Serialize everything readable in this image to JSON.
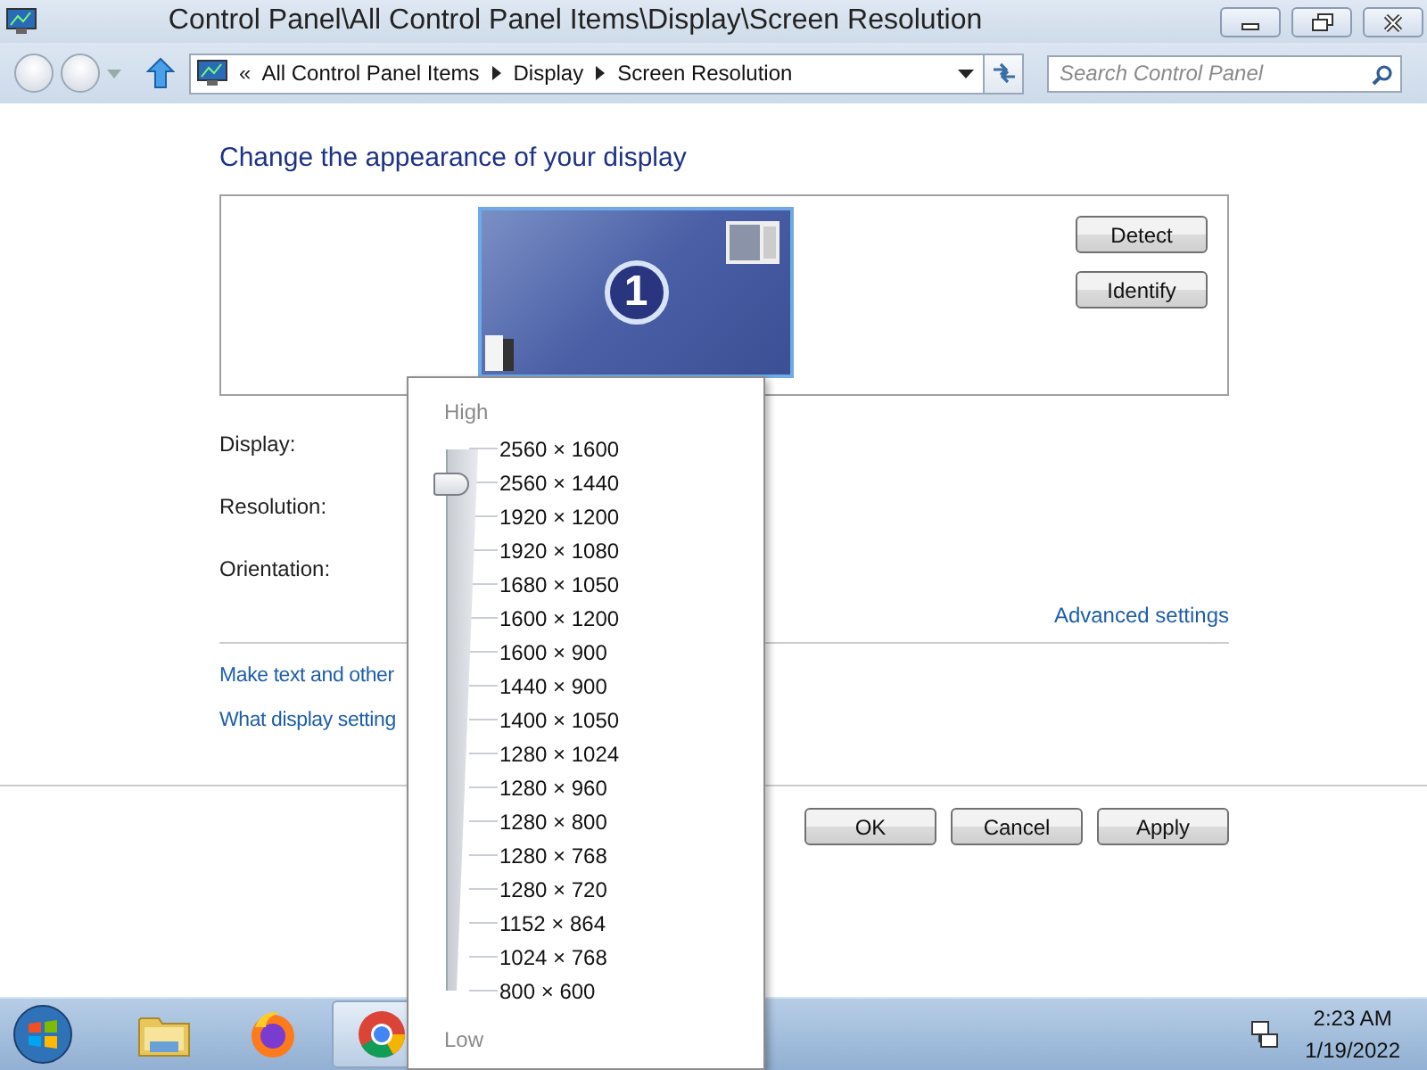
{
  "window": {
    "title": "Control Panel\\All Control Panel Items\\Display\\Screen Resolution"
  },
  "address_bar": {
    "prefix": "«",
    "crumbs": [
      "All Control Panel Items",
      "Display",
      "Screen Resolution"
    ]
  },
  "search": {
    "placeholder": "Search Control Panel"
  },
  "page": {
    "heading": "Change the appearance of your display",
    "monitor_number": "1",
    "buttons": [
      "Detect",
      "Identify"
    ],
    "fields": [
      "Display:",
      "Resolution:",
      "Orientation:"
    ],
    "advanced_link": "Advanced settings",
    "links": [
      "Make text and other",
      "What display setting"
    ],
    "dialog_buttons": [
      "OK",
      "Cancel",
      "Apply"
    ]
  },
  "resolution_popup": {
    "high_label": "High",
    "low_label": "Low",
    "level": 0.9375,
    "options": [
      "2560 × 1600",
      "2560 × 1440",
      "1920 × 1200",
      "1920 × 1080",
      "1680 × 1050",
      "1600 × 1200",
      "1600 × 900",
      "1440 × 900",
      "1400 × 1050",
      "1280 × 1024",
      "1280 × 960",
      "1280 × 800",
      "1280 × 768",
      "1280 × 720",
      "1152 × 864",
      "1024 × 768",
      "800 × 600"
    ]
  },
  "taskbar": {
    "apps": [
      {
        "kind": "explorer",
        "selected": false
      },
      {
        "kind": "firefox",
        "selected": false
      },
      {
        "kind": "chrome",
        "selected": true
      }
    ],
    "clock": {
      "time": "2:23 AM",
      "date": "1/19/2022"
    }
  }
}
